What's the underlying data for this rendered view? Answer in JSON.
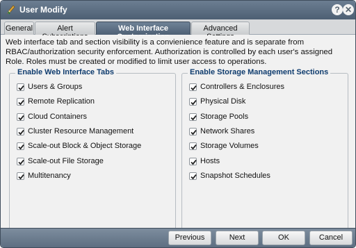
{
  "window": {
    "title": "User Modify"
  },
  "tabs": [
    {
      "label": "General"
    },
    {
      "label": "Alert Subscriptions"
    },
    {
      "label": "Web Interface Customization"
    },
    {
      "label": "Advanced Settings"
    }
  ],
  "description": "Web interface tab and section visibility is a convienience feature and is separate from RBAC/authorization security enforcement. Authorization is controlled by each user's assigned Role. Roles must be created or modified to limit user access to operations.",
  "left_group": {
    "legend": "Enable Web Interface Tabs",
    "items": [
      {
        "label": "Users & Groups",
        "checked": true
      },
      {
        "label": "Remote Replication",
        "checked": true
      },
      {
        "label": "Cloud Containers",
        "checked": true
      },
      {
        "label": "Cluster Resource Management",
        "checked": true
      },
      {
        "label": "Scale-out Block & Object Storage",
        "checked": true
      },
      {
        "label": "Scale-out File Storage",
        "checked": true
      },
      {
        "label": "Multitenancy",
        "checked": true
      }
    ]
  },
  "right_group": {
    "legend": "Enable Storage Management Sections",
    "items": [
      {
        "label": "Controllers & Enclosures",
        "checked": true
      },
      {
        "label": "Physical Disk",
        "checked": true
      },
      {
        "label": "Storage Pools",
        "checked": true
      },
      {
        "label": "Network Shares",
        "checked": true
      },
      {
        "label": "Storage Volumes",
        "checked": true
      },
      {
        "label": "Hosts",
        "checked": true
      },
      {
        "label": "Snapshot Schedules",
        "checked": true
      }
    ]
  },
  "buttons": {
    "previous": "Previous",
    "next": "Next",
    "ok": "OK",
    "cancel": "Cancel"
  },
  "icons": {
    "title": "pen-icon",
    "help": "help-icon",
    "close": "close-icon",
    "check": "checkmark-icon"
  },
  "colors": {
    "titlebar": "#5a6b7f",
    "legend_text": "#0f3c6e",
    "active_tab": "#5f7186"
  }
}
